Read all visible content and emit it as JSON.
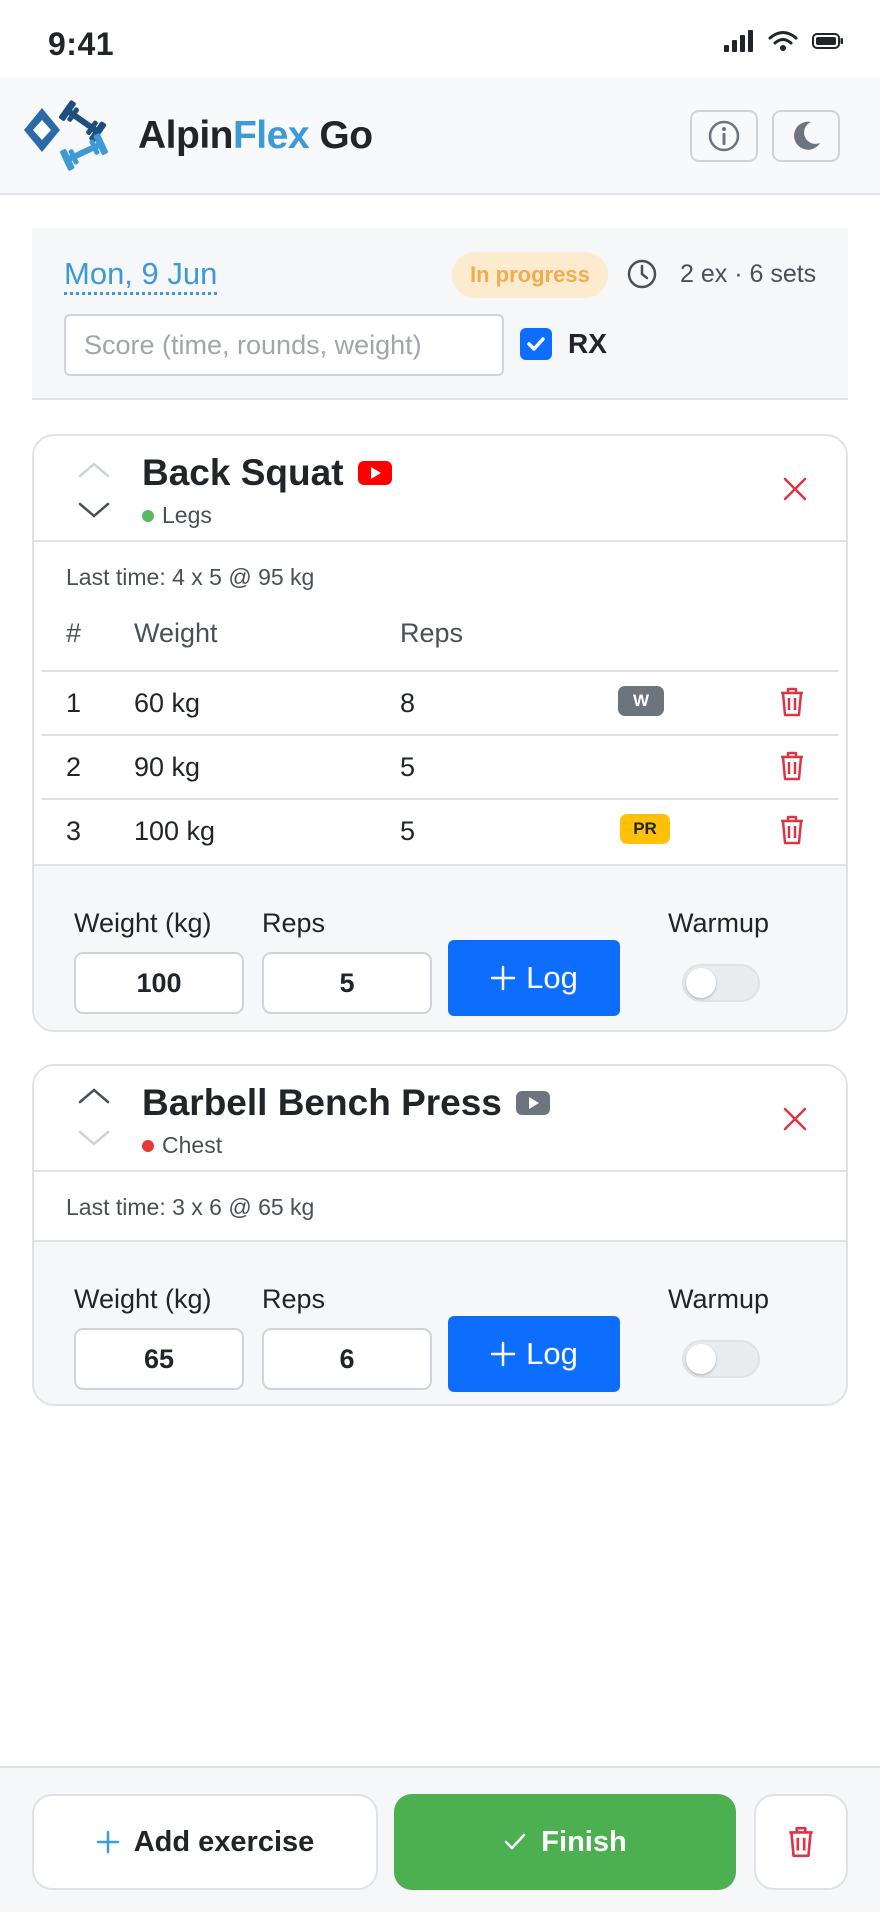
{
  "status_bar": {
    "time": "9:41"
  },
  "header": {
    "brand_part1": "Alpin",
    "brand_part2": "Flex",
    "brand_part3": " Go"
  },
  "session": {
    "date": "Mon, 9 Jun",
    "status": "In progress",
    "summary": "2 ex · 6 sets",
    "score_placeholder": "Score (time, rounds, weight)",
    "rx_checked": true,
    "rx_label": "RX"
  },
  "exercises": [
    {
      "name": "Back Squat",
      "muscle": "Legs",
      "muscle_color": "#5cb85c",
      "video_icon_color": "#ff0000",
      "last_time": "Last time: 4 x 5 @ 95 kg",
      "table_headers": {
        "num": "#",
        "weight": "Weight",
        "reps": "Reps"
      },
      "sets": [
        {
          "num": "1",
          "weight": "60 kg",
          "reps": "8",
          "badge": "W"
        },
        {
          "num": "2",
          "weight": "90 kg",
          "reps": "5",
          "badge": ""
        },
        {
          "num": "3",
          "weight": "100 kg",
          "reps": "5",
          "badge": "PR"
        }
      ],
      "log": {
        "weight_label": "Weight (kg)",
        "reps_label": "Reps",
        "weight_value": "100",
        "reps_value": "5",
        "log_label": "Log",
        "warmup_label": "Warmup",
        "warmup_on": false
      }
    },
    {
      "name": "Barbell Bench Press",
      "muscle": "Chest",
      "muscle_color": "#e53935",
      "video_icon_color": "#6c757d",
      "last_time": "Last time: 3 x 6 @ 65 kg",
      "log": {
        "weight_label": "Weight (kg)",
        "reps_label": "Reps",
        "weight_value": "65",
        "reps_value": "6",
        "log_label": "Log",
        "warmup_label": "Warmup",
        "warmup_on": false
      }
    }
  ],
  "footer": {
    "add_exercise": "Add exercise",
    "finish": "Finish"
  },
  "colors": {
    "primary": "#0d6efd",
    "success": "#4caf50",
    "danger": "#dc3545",
    "brand_accent": "#3d9ad6",
    "warning": "#f0ad4e"
  }
}
